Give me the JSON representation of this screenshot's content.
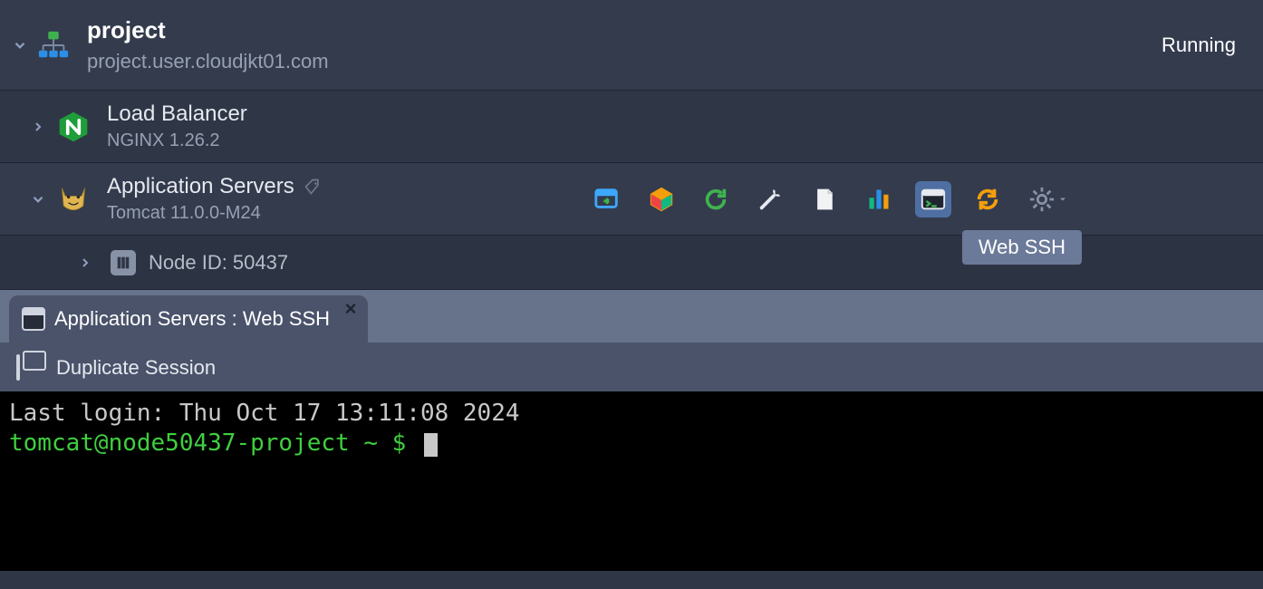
{
  "environment": {
    "name": "project",
    "domain": "project.user.cloudjkt01.com",
    "status": "Running"
  },
  "layers": [
    {
      "title": "Load Balancer",
      "subtitle": "NGINX 1.26.2",
      "expanded": false
    },
    {
      "title": "Application Servers",
      "subtitle": "Tomcat 11.0.0-M24",
      "expanded": true
    }
  ],
  "node": {
    "id_label": "Node ID: 50437"
  },
  "toolbar": {
    "tooltip": "Web SSH"
  },
  "tab": {
    "label": "Application Servers : Web SSH"
  },
  "session_bar": {
    "duplicate_label": "Duplicate Session"
  },
  "terminal": {
    "last_login": "Last login: Thu Oct 17 13:11:08 2024",
    "prompt": "tomcat@node50437-project ~ $ "
  }
}
